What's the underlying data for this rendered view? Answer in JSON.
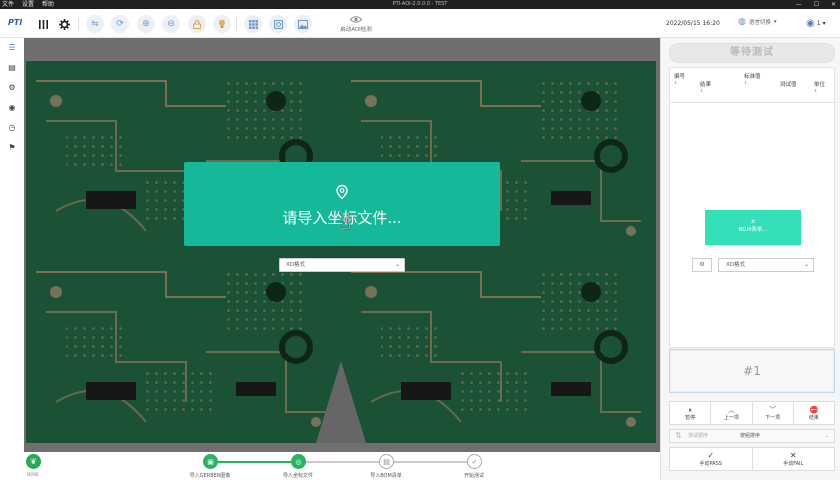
{
  "window": {
    "menu": [
      "文件",
      "设置",
      "帮助"
    ],
    "title": "PTI-AOI-2.0.0.0 - TEST",
    "controls": [
      "—",
      "☐",
      "✕"
    ]
  },
  "toolbar": {
    "logo": "PTI",
    "aoi_label": "启动AOI检测",
    "datetime": "2022/05/15 16:20",
    "language": "语言切换",
    "language_arrow": "▾",
    "user": "1",
    "user_arrow": "▾"
  },
  "viewer": {
    "import_text": "请导入坐标文件...",
    "format_select": "XD格式",
    "format_arrow": "⌄"
  },
  "steps": {
    "leaf_label": "DOVE",
    "items": [
      {
        "label": "导入GERBER图像",
        "state": "done"
      },
      {
        "label": "导入坐标文件",
        "state": "done"
      },
      {
        "label": "导入BOM清单",
        "state": "todo"
      },
      {
        "label": "开始测试",
        "state": "todo"
      }
    ]
  },
  "panel": {
    "status": "等待测试",
    "columns": {
      "id": "编号",
      "result": "结果",
      "standard": "标准值",
      "measured": "测试值",
      "unit": "单位"
    },
    "sort_glyph": "⬍",
    "bom_button": "BOM表单...",
    "bom_button_icon": "±",
    "bom_format": "XD格式",
    "bom_arrow": "⌄",
    "serial": "#1",
    "controls": {
      "pause": "暂停",
      "prev": "上一项",
      "next": "下一项",
      "stop": "结束"
    },
    "mode_label": "测试顺序",
    "mode_value": "按组排序",
    "mode_arrow": "⌄",
    "manual_pass": "手动PASS",
    "manual_fail": "手动FAIL"
  },
  "colors": {
    "accent_green": "#16b89a",
    "step_green": "#28b463",
    "bom_button": "#33e0b8",
    "pcb_green": "#1e5a3a",
    "pcb_trace": "#b08a6a"
  }
}
